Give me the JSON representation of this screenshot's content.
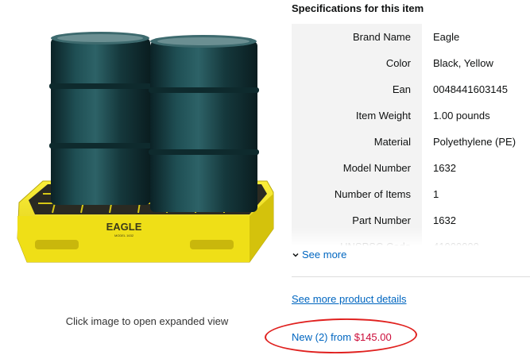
{
  "image": {
    "caption": "Click image to open expanded view",
    "pallet_brand": "EAGLE",
    "pallet_model": "MODEL 1632"
  },
  "specs": {
    "heading": "Specifications for this item",
    "rows": [
      {
        "label": "Brand Name",
        "value": "Eagle"
      },
      {
        "label": "Color",
        "value": "Black, Yellow"
      },
      {
        "label": "Ean",
        "value": "0048441603145"
      },
      {
        "label": "Item Weight",
        "value": "1.00 pounds"
      },
      {
        "label": "Material",
        "value": "Polyethylene (PE)"
      },
      {
        "label": "Model Number",
        "value": "1632"
      },
      {
        "label": "Number of Items",
        "value": "1"
      },
      {
        "label": "Part Number",
        "value": "1632"
      },
      {
        "label": "UNSPSC Code",
        "value": "41000000"
      }
    ],
    "see_more": "See more",
    "product_details_link": "See more product details"
  },
  "offer": {
    "prefix": "New (2) from ",
    "price": "$145.00"
  },
  "colors": {
    "link": "#0066c0",
    "price": "#cc0c39",
    "annotation": "#e0211f",
    "pallet_yellow": "#f2e21a",
    "drum": "#143a3e"
  }
}
